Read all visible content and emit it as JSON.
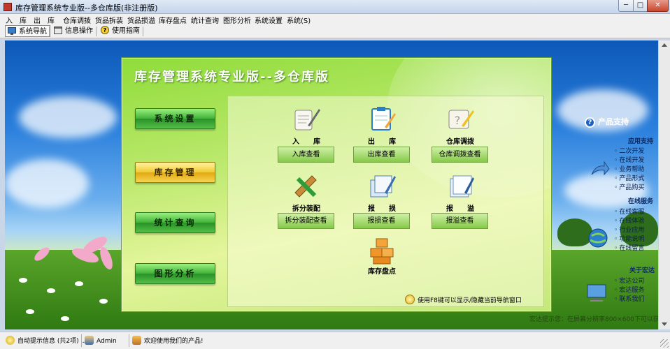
{
  "window": {
    "title": "库存管理系统专业版--多仓库版(非注册版)",
    "min_glyph": "─",
    "max_glyph": "□",
    "close_glyph": "✕"
  },
  "menu": [
    "入　库",
    "出　库",
    "仓库调拨",
    "货品拆装",
    "货品损溢",
    "库存盘点",
    "统计查询",
    "图形分析",
    "系统设置",
    "系统(S)"
  ],
  "toolbar": [
    {
      "label": "系统导航",
      "icon": "monitor-icon",
      "active": true
    },
    {
      "label": "信息操作",
      "icon": "window-icon",
      "active": false
    },
    {
      "label": "使用指南",
      "icon": "help-icon",
      "active": false
    }
  ],
  "panel": {
    "title": "库存管理系统专业版--多仓库版",
    "side_buttons": [
      {
        "label": "系统设置",
        "selected": false
      },
      {
        "label": "库存管理",
        "selected": true
      },
      {
        "label": "统计查询",
        "selected": false
      },
      {
        "label": "图形分析",
        "selected": false
      }
    ],
    "features": [
      {
        "label": "入　　库",
        "button": "入库查看",
        "icon": "scroll-quill-icon"
      },
      {
        "label": "出　　库",
        "button": "出库查看",
        "icon": "clipboard-pencil-icon"
      },
      {
        "label": "仓库调拨",
        "button": "仓库调拨查看",
        "icon": "notepad-question-icon"
      },
      {
        "label": "拆分装配",
        "button": "拆分装配查看",
        "icon": "ruler-pencil-icon"
      },
      {
        "label": "报　　损",
        "button": "报损查看",
        "icon": "documents-pen-icon"
      },
      {
        "label": "报　　溢",
        "button": "报溢查看",
        "icon": "papers-pen-icon"
      },
      {
        "label": "库存盘点",
        "button": "",
        "icon": "boxes-icon"
      }
    ],
    "hint": "使用F8键可以显示/隐藏当前导航窗口"
  },
  "right_panel": {
    "support_title": "产品支持",
    "sections": [
      {
        "heading": "应用支持",
        "items": [
          "二次开发",
          "在线开发",
          "业务帮助",
          "产品形式",
          "产品购买"
        ]
      },
      {
        "heading": "在线服务",
        "items": [
          "在线客服",
          "在线体验",
          "行业应用",
          "功能说明",
          "在线留言"
        ]
      },
      {
        "heading": "关于宏达",
        "items": [
          "宏达公司",
          "宏达服务",
          "联系我们"
        ]
      }
    ]
  },
  "footer_note": "宏达提示您：在屏幕分辨率800×600下可以获得最佳效果",
  "status": [
    {
      "label": "自动提示信息 (共2项) ...",
      "icon": "bulb-icon"
    },
    {
      "label": "Admin",
      "icon": "user-icon"
    },
    {
      "label": "欢迎使用我们的产品!",
      "icon": "box-icon"
    }
  ],
  "colors": {
    "panel_green": "#b9e86a",
    "selected_button": "#f2c830",
    "side_button": "#3fb238",
    "sky": "#2a7fdc"
  }
}
